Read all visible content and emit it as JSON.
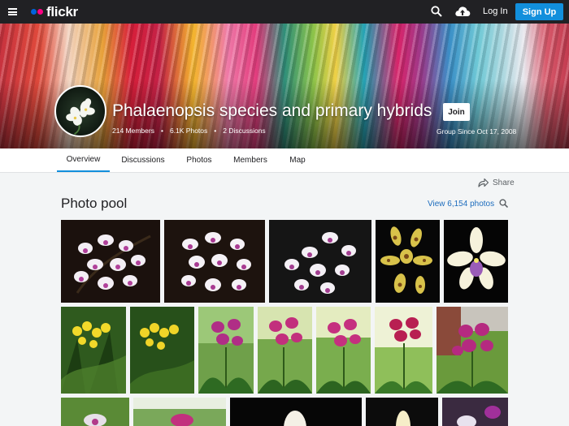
{
  "nav": {
    "logo_text": "flickr",
    "login_label": "Log In",
    "signup_label": "Sign Up",
    "icons": [
      "menu-icon",
      "search-icon",
      "upload-cloud-icon"
    ]
  },
  "group": {
    "title": "Phalaenopsis species and primary hybrids",
    "join_label": "Join",
    "members": "214 Members",
    "photos": "6.1K Photos",
    "discussions": "2 Discussions",
    "separator": "•",
    "since": "Group Since Oct 17, 2008"
  },
  "tabs": [
    {
      "label": "Overview",
      "active": true
    },
    {
      "label": "Discussions",
      "active": false
    },
    {
      "label": "Photos",
      "active": false
    },
    {
      "label": "Members",
      "active": false
    },
    {
      "label": "Map",
      "active": false
    }
  ],
  "pool": {
    "share_label": "Share",
    "title": "Photo pool",
    "view_all": "View 6,154 photos"
  },
  "colors": {
    "topbar": "#212124",
    "accent_blue": "#128fdc",
    "flickr_blue": "#0063dc",
    "flickr_pink": "#ff0084",
    "link": "#1c6cbd"
  }
}
